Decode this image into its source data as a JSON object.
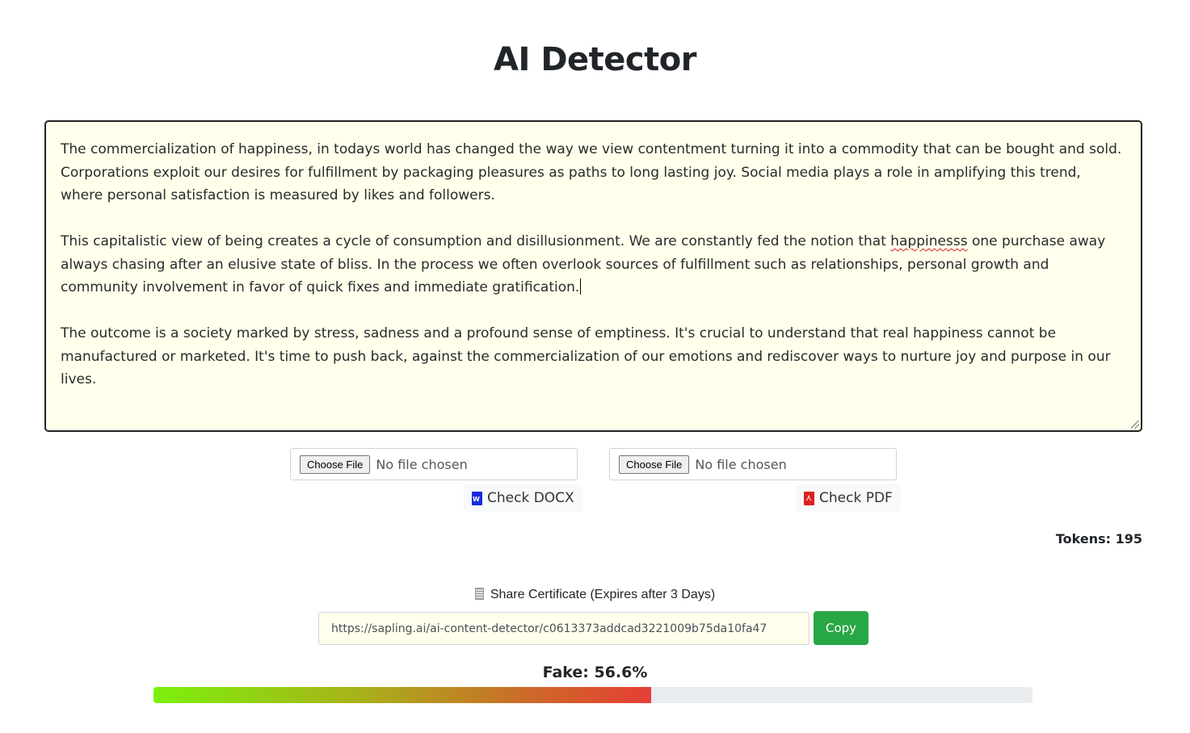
{
  "page": {
    "title": "AI Detector"
  },
  "editor": {
    "paragraphs": [
      {
        "text": "The commercialization of happiness, in todays world has changed the way we view contentment turning it into a commodity that can be bought and sold. Corporations exploit our desires for fulfillment by packaging pleasures as paths to long lasting joy. Social media plays a role in amplifying this trend, where personal satisfaction is measured by likes and followers."
      },
      {
        "before": "This capitalistic view of being creates a cycle of consumption and disillusionment. We are constantly fed the notion that ",
        "misspelled": "happinesss",
        "after": " one purchase away always chasing after an elusive state of bliss. In the process we often overlook sources of fulfillment such as relationships, personal growth and community involvement in favor of quick fixes and immediate gratification."
      },
      {
        "text": "The outcome is a society marked by stress, sadness and a profound sense of emptiness. It's crucial to understand that real happiness cannot be manufactured or marketed. It's time to push back, against the commercialization of our emotions and rediscover ways to nurture joy and purpose in our lives."
      }
    ]
  },
  "uploads": {
    "docx": {
      "choose_label": "Choose File",
      "status": "No file chosen",
      "check_label": "Check DOCX",
      "icon": "word-file-icon"
    },
    "pdf": {
      "choose_label": "Choose File",
      "status": "No file chosen",
      "check_label": "Check PDF",
      "icon": "pdf-file-icon"
    }
  },
  "stats": {
    "tokens_label": "Tokens: 195",
    "tokens": 195
  },
  "share": {
    "label": "Share Certificate (Expires after 3 Days)",
    "icon": "document-icon",
    "url": "https://sapling.ai/ai-content-detector/c0613373addcad3221009b75da10fa47",
    "copy_label": "Copy"
  },
  "result": {
    "fake_label": "Fake: 56.6%",
    "fake_percent": 56.6,
    "colors": {
      "gradient_start": "#7cf00c",
      "gradient_end": "#e63e36",
      "track": "#e9ecef",
      "copy_button": "#28a745",
      "editor_bg": "#ffffec"
    }
  }
}
